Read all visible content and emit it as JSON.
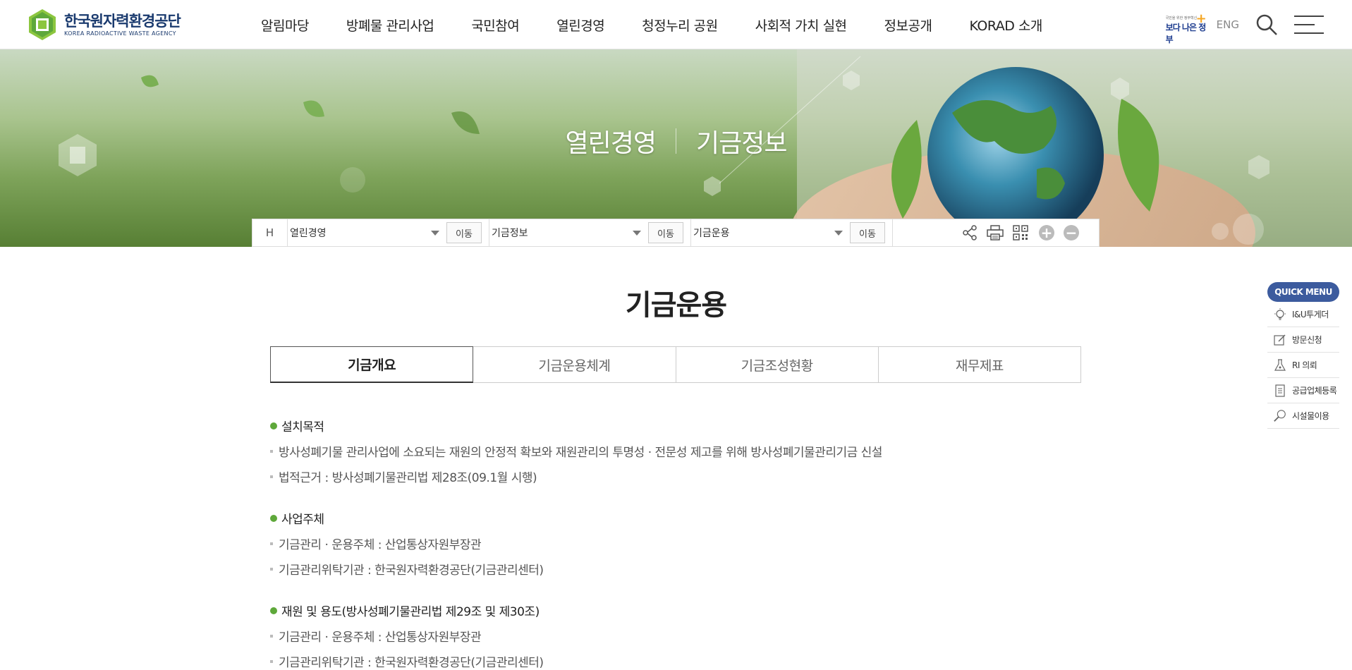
{
  "header": {
    "logo": {
      "name": "한국원자력환경공단",
      "sub": "KOREA RADIOACTIVE WASTE AGENCY"
    },
    "nav": [
      "알림마당",
      "방폐물 관리사업",
      "국민참여",
      "열린경영",
      "청정누리 공원",
      "사회적 가치 실현",
      "정보공개",
      "KORAD 소개"
    ],
    "better_gov": {
      "small": "국민을 위한 정부혁신",
      "big": "보다 나은 정부"
    },
    "eng_label": "ENG"
  },
  "banner": {
    "title_1": "열린경영",
    "title_2": "기금정보"
  },
  "location": {
    "home_label": "H",
    "segments": [
      {
        "value": "열린경영",
        "button": "이동"
      },
      {
        "value": "기금정보",
        "button": "이동"
      },
      {
        "value": "기금운용",
        "button": "이동"
      }
    ]
  },
  "page_title": "기금운용",
  "tabs": [
    {
      "label": "기금개요",
      "active": true
    },
    {
      "label": "기금운용체계",
      "active": false
    },
    {
      "label": "기금조성현황",
      "active": false
    },
    {
      "label": "재무제표",
      "active": false
    }
  ],
  "sections": [
    {
      "title": "설치목적",
      "items": [
        "방사성폐기물 관리사업에 소요되는 재원의 안정적 확보와 재원관리의 투명성 · 전문성 제고를 위해 방사성폐기물관리기금 신설",
        "법적근거 : 방사성폐기물관리법 제28조(09.1월 시행)"
      ]
    },
    {
      "title": "사업주체",
      "items": [
        "기금관리 · 운용주체 : 산업통상자원부장관",
        "기금관리위탁기관 : 한국원자력환경공단(기금관리센터)"
      ]
    },
    {
      "title": "재원 및 용도(방사성폐기물관리법 제29조 및 제30조)",
      "items": [
        "기금관리 · 운용주체 : 산업통상자원부장관",
        "기금관리위탁기관 : 한국원자력환경공단(기금관리센터)"
      ]
    }
  ],
  "quick_menu": {
    "title": "QUICK MENU",
    "items": [
      "I&U투게더",
      "방문신청",
      "RI 의뢰",
      "공급업체등록",
      "시설물이용"
    ]
  },
  "colors": {
    "brand_green": "#5ea83a",
    "brand_navy": "#1a3a6e",
    "quick_blue": "#3c5b9e"
  }
}
